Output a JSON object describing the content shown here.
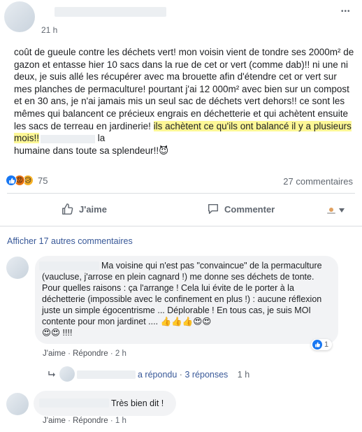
{
  "post": {
    "time": "21 h",
    "more": "•••",
    "text_before": "coût de gueule contre les déchets vert! mon voisin vient de tondre ses 2000m² de gazon et entasse hier 10 sacs dans la rue de cet or vert (comme dab)!! ni une ni deux, je suis allé les récupérer avec ma brouette afin d'étendre cet or vert sur mes planches de permaculture! pourtant j'ai 12 000m² avec bien sur un compost et en 30 ans, je n'ai jamais mis un seul sac de déchets vert dehors!! ce sont les mêmes qui balancent ce précieux engrais en déchetterie et qui achètent ensuite les sacs de terreau en jardinerie! ",
    "text_highlight": "ils achètent ce qu'ils ont balancé il y a plusieurs mois!!",
    "text_after_1": " la",
    "text_after_2": "humaine dans toute sa splendeur!!",
    "text_emoji": "😈",
    "reaction_count": "75",
    "comments_count": "27 commentaires",
    "like_label": "J'aime",
    "comment_label": "Commenter"
  },
  "comments": {
    "more_label": "Afficher 17 autres commentaires",
    "c1": {
      "text": "Ma voisine qui n'est pas \"convaincue\" de la permaculture (vaucluse, j'arrose en plein cagnard !) me donne ses déchets de tonte. Pour quelles raisons : ça l'arrange ! Cela lui évite de le porter à la déchetterie (impossible avec le confinement en plus !) : aucune réflexion juste un simple égocentrisme ... Déplorable ! En tous cas, je suis MOI contente pour mon jardinet ....",
      "emojis_line1": "👍👍👍😍😍",
      "emojis_line2": "😍😍",
      "suffix": "!!!!",
      "like": "J'aime",
      "sep": "·",
      "reply": "Répondre",
      "time": "2 h",
      "reaction_count": "1"
    },
    "reply_row": {
      "replied": "a répondu",
      "sep": "·",
      "count": "3 réponses",
      "time": "1 h"
    },
    "c2": {
      "text": "Très bien dit !",
      "like": "J'aime",
      "sep": "·",
      "reply": "Répondre",
      "time": "1 h"
    }
  },
  "colors": {
    "link": "#385898",
    "like_blue": "#1877f2",
    "angry": "#e9710f",
    "highlight": "#fdf796"
  }
}
